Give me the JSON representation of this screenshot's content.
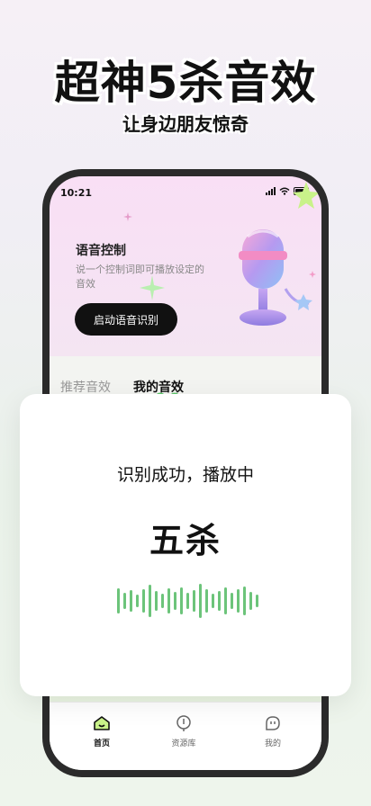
{
  "headline": "超神5杀音效",
  "subline": "让身边朋友惊奇",
  "status_bar": {
    "time": "10:21"
  },
  "voice": {
    "title": "语音控制",
    "description": "说一个控制词即可播放设定的音效",
    "button_label": "启动语音识别"
  },
  "tabs": [
    {
      "label": "推荐音效",
      "active": false
    },
    {
      "label": "我的音效",
      "active": true
    }
  ],
  "card": {
    "status": "识别成功，播放中",
    "result": "五杀",
    "wave_color": "#6cc47a"
  },
  "nav": [
    {
      "label": "首页",
      "icon": "home-icon",
      "active": true
    },
    {
      "label": "资源库",
      "icon": "library-icon",
      "active": false
    },
    {
      "label": "我的",
      "icon": "profile-icon",
      "active": false
    }
  ],
  "colors": {
    "accent_green": "#6cc47a",
    "dark": "#111111"
  }
}
